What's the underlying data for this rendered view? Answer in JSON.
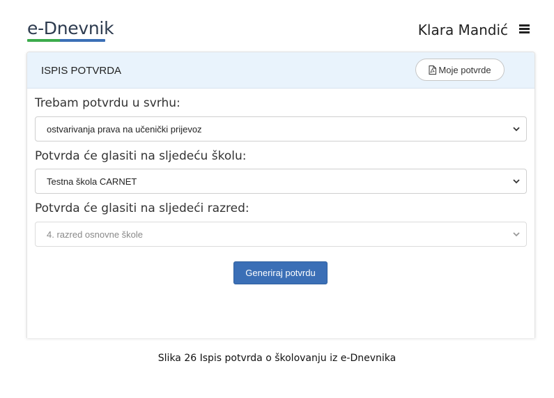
{
  "header": {
    "logo_text": "e-Dnevnik",
    "user_name": "Klara Mandić",
    "menu_icon": "hamburger-menu-icon"
  },
  "card": {
    "title": "ISPIS POTVRDA",
    "my_certs_button": "Moje potvrde",
    "my_certs_icon": "pdf-file-icon",
    "fields": [
      {
        "label": "Trebam potvrdu u svrhu:",
        "value": "ostvarivanja prava na učenički prijevoz",
        "disabled": false
      },
      {
        "label": "Potvrda će glasiti na sljedeću školu:",
        "value": "Testna škola CARNET",
        "disabled": false
      },
      {
        "label": "Potvrda će glasiti na sljedeći razred:",
        "value": "4. razred osnovne škole",
        "disabled": true
      }
    ],
    "generate_button": "Generiraj potvrdu"
  },
  "caption": "Slika 26 Ispis potvrda o školovanju iz e-Dnevnika",
  "colors": {
    "brand_green": "#3cab4c",
    "brand_blue": "#3b6fb6",
    "header_bg": "#e9f3fc"
  }
}
